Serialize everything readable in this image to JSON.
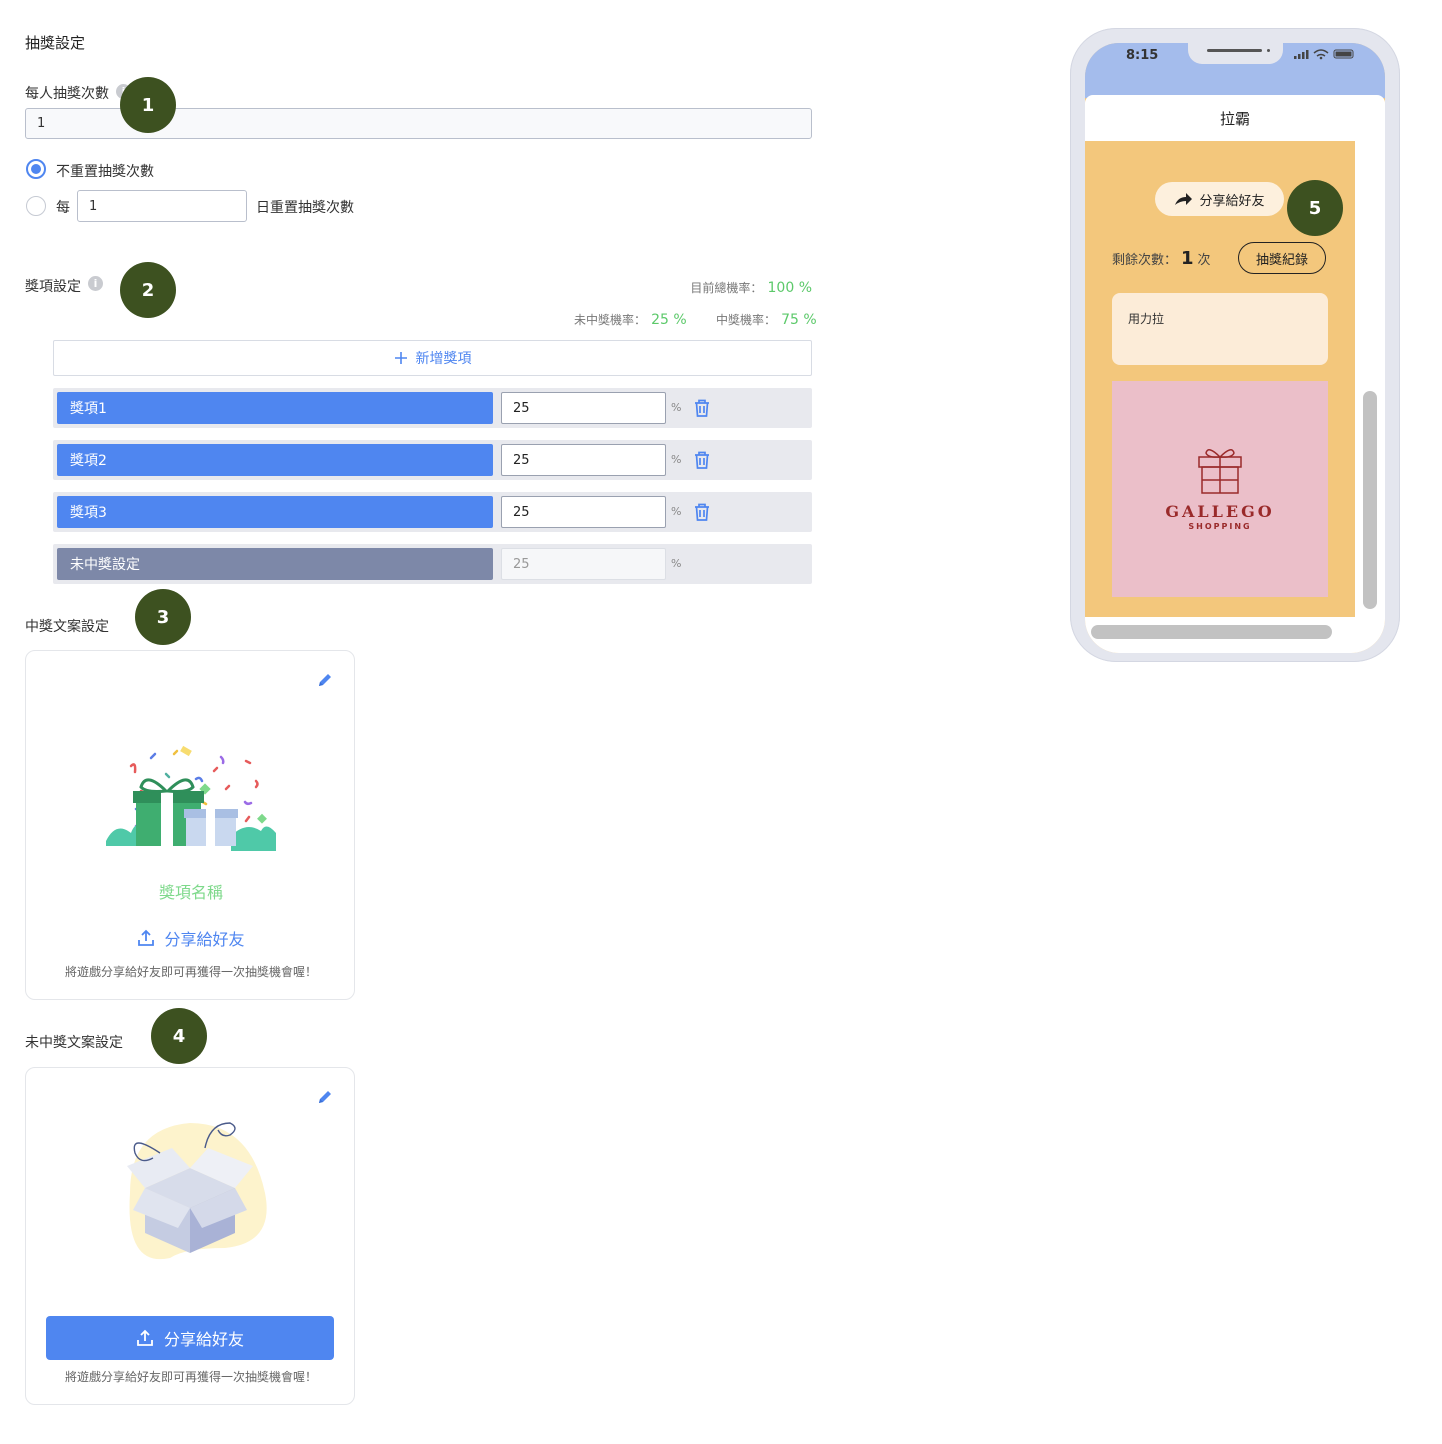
{
  "section_title": "抽獎設定",
  "draws": {
    "label": "每人抽獎次數",
    "value": "1",
    "radio_no_reset": "不重置抽獎次數",
    "radio_every_prefix": "每",
    "every_value": "1",
    "radio_every_suffix": "日重置抽獎次數"
  },
  "prize_settings": {
    "label": "獎項設定",
    "total_rate_label": "目前總機率：",
    "total_rate_value": "100 %",
    "lose_rate_label": "未中獎機率：",
    "lose_rate_value": "25 %",
    "win_rate_label": "中獎機率：",
    "win_rate_value": "75 %",
    "add_label": "新增獎項",
    "percent_sign": "%",
    "items": [
      {
        "name": "獎項1",
        "value": "25"
      },
      {
        "name": "獎項2",
        "value": "25"
      },
      {
        "name": "獎項3",
        "value": "25"
      },
      {
        "name": "未中獎設定",
        "value": "25"
      }
    ]
  },
  "win_copy": {
    "label": "中獎文案設定",
    "prize_name": "獎項名稱",
    "share_label": "分享給好友",
    "hint": "將遊戲分享給好友即可再獲得一次抽獎機會喔！"
  },
  "lose_copy": {
    "label": "未中獎文案設定",
    "share_label": "分享給好友",
    "hint": "將遊戲分享給好友即可再獲得一次抽獎機會喔！"
  },
  "badges": [
    "1",
    "2",
    "3",
    "4",
    "5"
  ],
  "phone": {
    "time": "8:15",
    "header_title": "拉霸",
    "share_label": "分享給好友",
    "remaining_label": "剩餘次數：",
    "remaining_value": "1",
    "remaining_unit": "次",
    "record_button": "抽獎紀錄",
    "pull_text": "用力拉",
    "brand_name": "GALLEGO",
    "brand_sub": "SHOPPING"
  },
  "colors": {
    "accent": "#4f86f0",
    "green_rate": "#5cc96a",
    "badge": "#3d5120",
    "phone_bg": "#f3c77c",
    "brand_red": "#9a2a2a"
  }
}
